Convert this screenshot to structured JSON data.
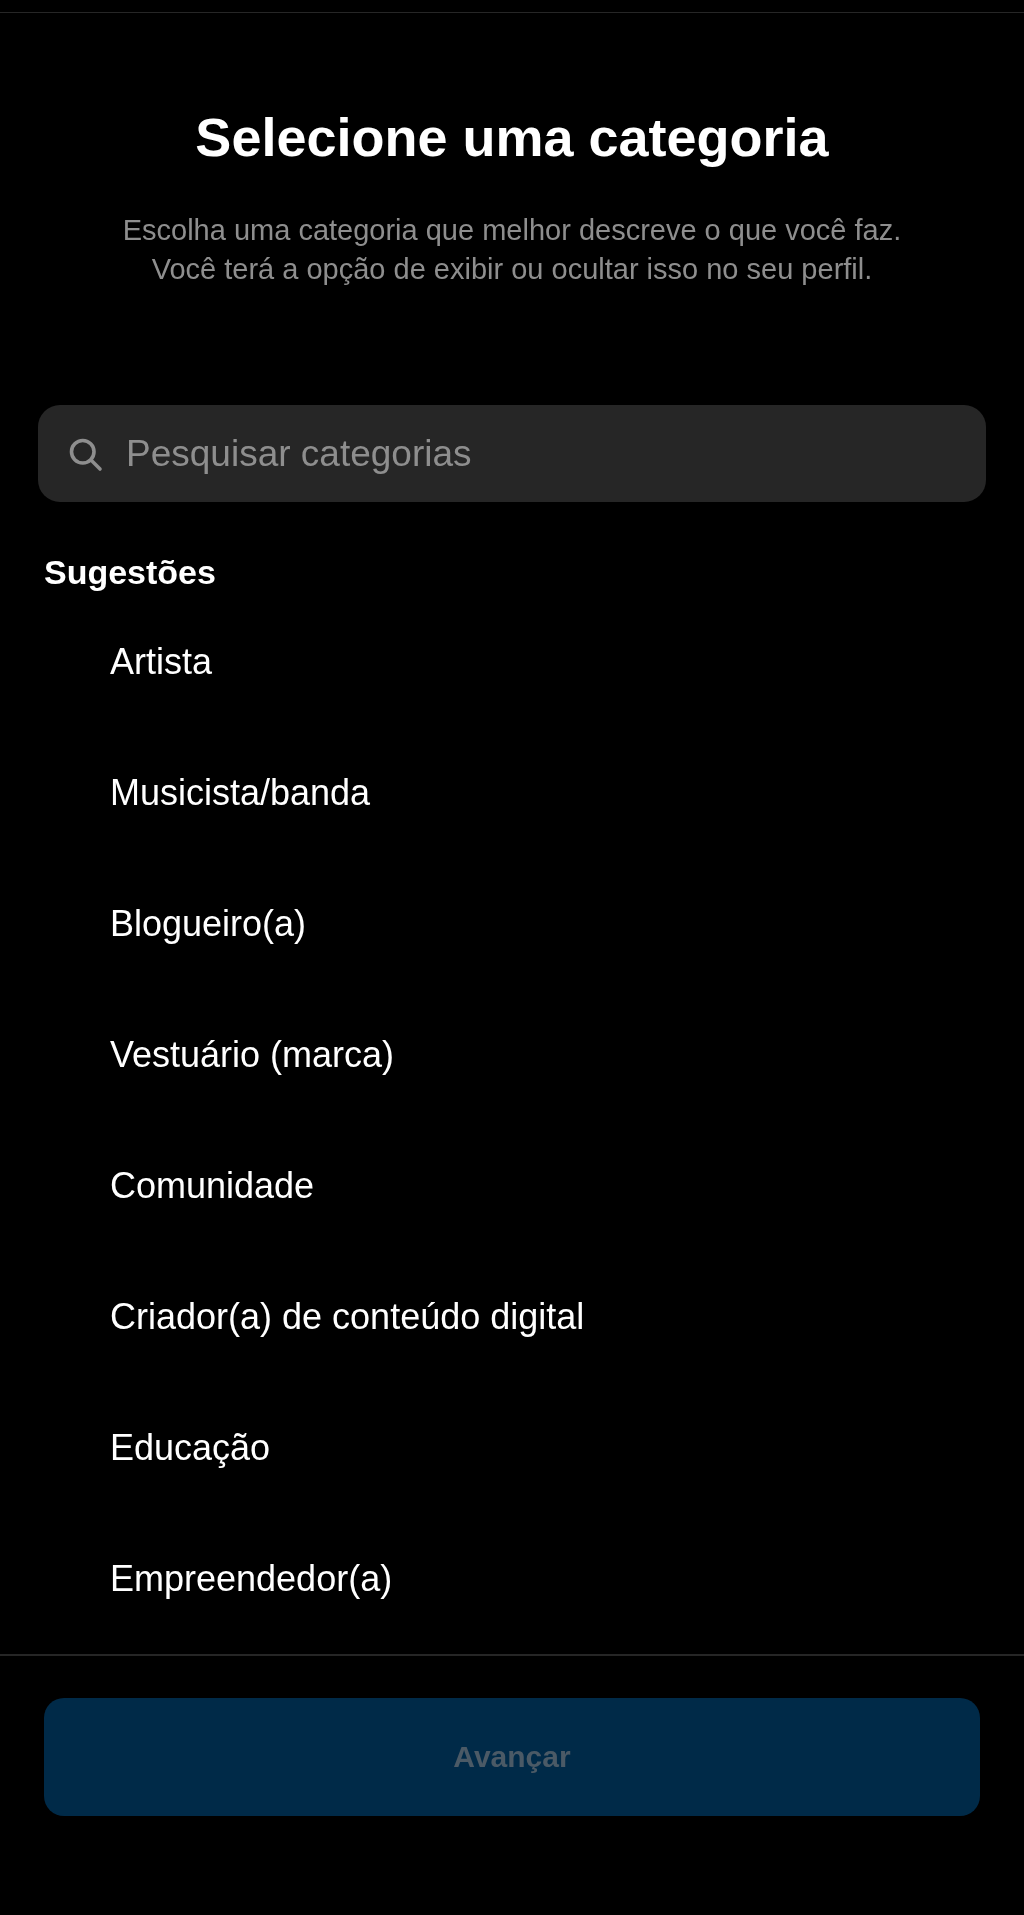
{
  "title": "Selecione uma categoria",
  "subtitle": "Escolha uma categoria que melhor descreve o que você faz. Você terá a opção de exibir ou ocultar isso no seu perfil.",
  "search": {
    "placeholder": "Pesquisar categorias"
  },
  "section_title": "Sugestões",
  "suggestions": [
    "Artista",
    "Musicista/banda",
    "Blogueiro(a)",
    "Vestuário (marca)",
    "Comunidade",
    "Criador(a) de conteúdo digital",
    "Educação",
    "Empreendedor(a)"
  ],
  "next_button": {
    "label": "Avançar",
    "disabled": true
  }
}
